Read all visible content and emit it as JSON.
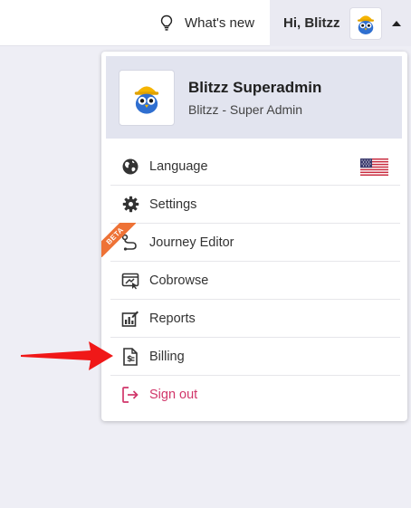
{
  "header": {
    "whats_new_label": "What's new",
    "greeting": "Hi, Blitzz"
  },
  "profile": {
    "name": "Blitzz Superadmin",
    "role": "Blitzz - Super Admin"
  },
  "menu": {
    "language_label": "Language",
    "settings_label": "Settings",
    "journey_editor_label": "Journey Editor",
    "journey_badge": "BETA",
    "cobrowse_label": "Cobrowse",
    "reports_label": "Reports",
    "billing_label": "Billing",
    "signout_label": "Sign out"
  },
  "icons": {
    "whats_new": "lightbulb-icon",
    "language": "globe-icon",
    "settings": "gear-icon",
    "journey": "route-icon",
    "cobrowse": "cobrowse-icon",
    "reports": "chart-edit-icon",
    "billing": "invoice-icon",
    "signout": "sign-out-icon",
    "flag": "us-flag-icon"
  },
  "colors": {
    "accent_red": "#f01818",
    "signout": "#d1366a",
    "beta_badge": "#ee7236",
    "owl_blue": "#2f6fd0",
    "helmet_yellow": "#f5b400"
  }
}
